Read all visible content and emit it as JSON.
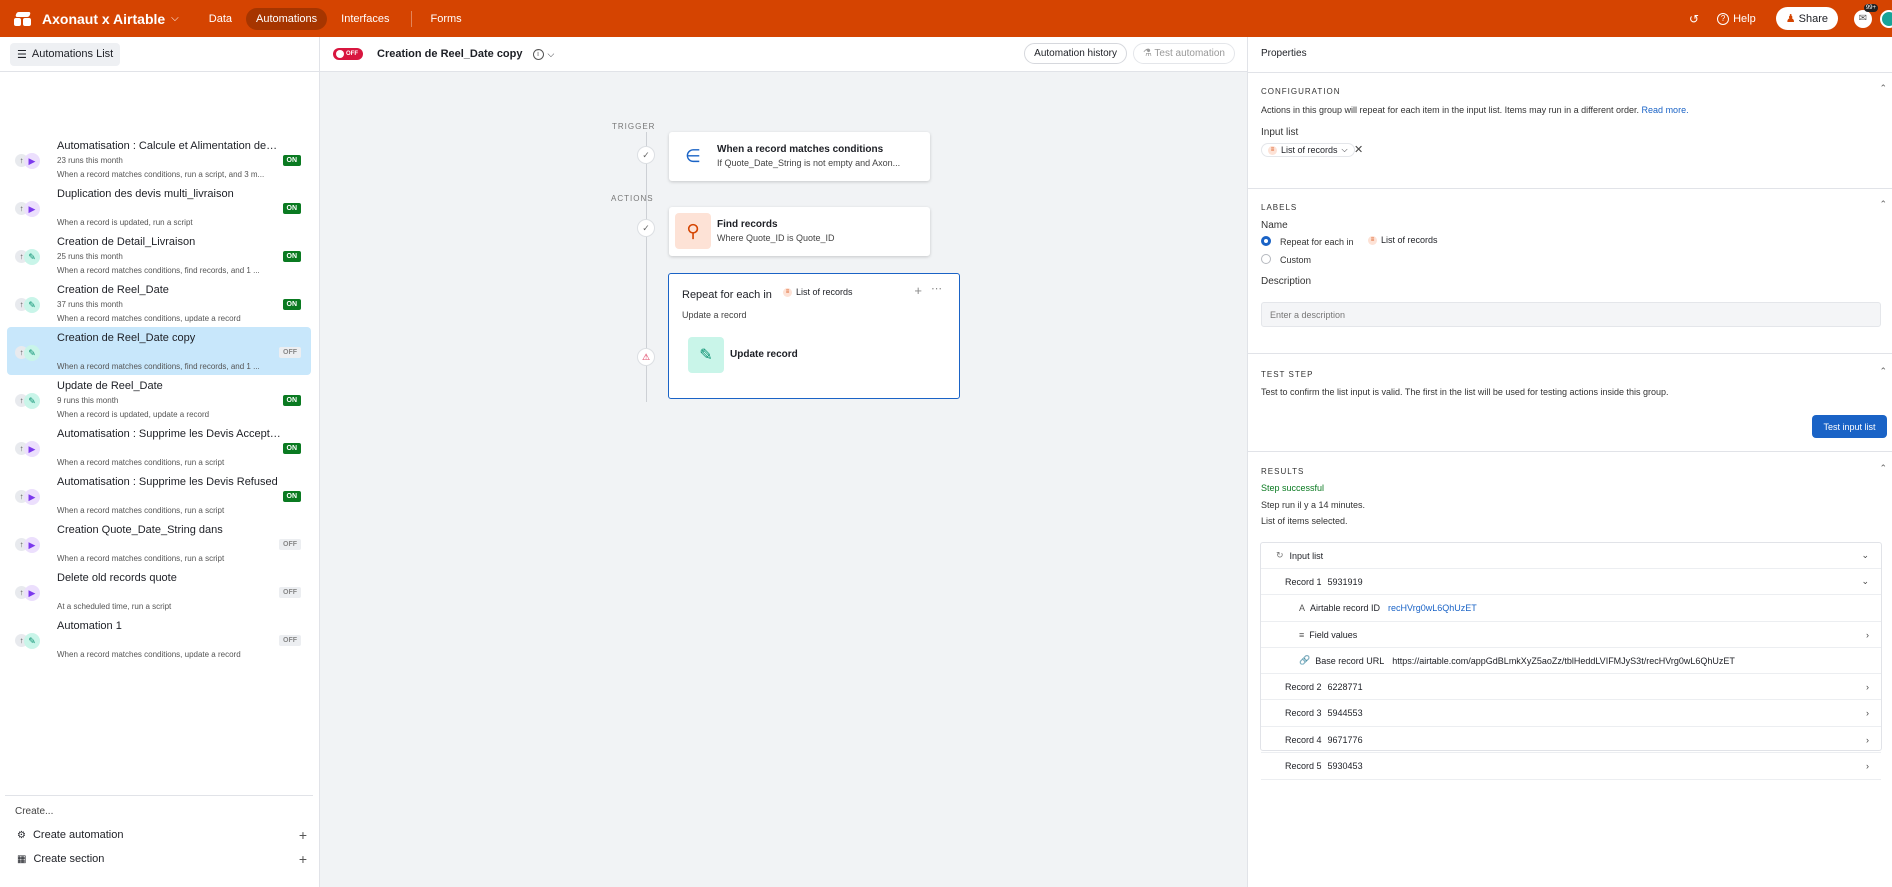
{
  "topbar": {
    "base_name": "Axonaut x Airtable",
    "tabs": [
      "Data",
      "Automations",
      "Interfaces",
      "Forms"
    ],
    "active_tab": "Automations",
    "help": "Help",
    "share": "Share",
    "notif_badge": "99+",
    "colors": {
      "bar": "#d54401"
    }
  },
  "sidebar": {
    "list_button": "Automations List",
    "automations": [
      {
        "title": "Automatisation : Calcule et Alimentation des t...",
        "runs": "23 runs this month",
        "desc": "When a record matches conditions, run a script, and 3 m...",
        "status": "ON",
        "icon": "script"
      },
      {
        "title": "Duplication des devis multi_livraison",
        "runs": "",
        "desc": "When a record is updated, run a script",
        "status": "ON",
        "icon": "script"
      },
      {
        "title": "Creation de Detail_Livraison",
        "runs": "25 runs this month",
        "desc": "When a record matches conditions, find records, and 1 ...",
        "status": "ON",
        "icon": "update"
      },
      {
        "title": "Creation de Reel_Date",
        "runs": "37 runs this month",
        "desc": "When a record matches conditions, update a record",
        "status": "ON",
        "icon": "update"
      },
      {
        "title": "Creation de Reel_Date copy",
        "runs": "",
        "desc": "When a record matches conditions, find records, and 1 ...",
        "status": "OFF",
        "icon": "update"
      },
      {
        "title": "Update de Reel_Date",
        "runs": "9 runs this month",
        "desc": "When a record is updated, update a record",
        "status": "ON",
        "icon": "update"
      },
      {
        "title": "Automatisation : Supprime les Devis Accepted...",
        "runs": "",
        "desc": "When a record matches conditions, run a script",
        "status": "ON",
        "icon": "script"
      },
      {
        "title": "Automatisation : Supprime les Devis Refused",
        "runs": "",
        "desc": "When a record matches conditions, run a script",
        "status": "ON",
        "icon": "script"
      },
      {
        "title": "Creation Quote_Date_String dans",
        "runs": "",
        "desc": "When a record matches conditions, run a script",
        "status": "OFF",
        "icon": "script"
      },
      {
        "title": "Delete old records quote",
        "runs": "",
        "desc": "At a scheduled time, run a script",
        "status": "OFF",
        "icon": "script"
      },
      {
        "title": "Automation 1",
        "runs": "",
        "desc": "When a record matches conditions, update a record",
        "status": "OFF",
        "icon": "update"
      }
    ],
    "create_label": "Create...",
    "create_automation": "Create automation",
    "create_section": "Create section"
  },
  "canvas": {
    "toggle": "OFF",
    "automation_name": "Creation de Reel_Date copy",
    "history_button": "Automation history",
    "test_button": "Test automation",
    "trigger_label": "TRIGGER",
    "actions_label": "ACTIONS",
    "trigger_card": {
      "title": "When a record matches conditions",
      "subtitle": "If Quote_Date_String is not empty and Axon..."
    },
    "find_card": {
      "title": "Find records",
      "subtitle": "Where Quote_ID is Quote_ID"
    },
    "repeat_card": {
      "title": "Repeat for each in",
      "chip": "List of records",
      "subtitle": "Update a record",
      "inner_action": "Update record"
    }
  },
  "properties": {
    "title": "Properties",
    "configuration": {
      "heading": "CONFIGURATION",
      "text": "Actions in this group will repeat for each item in the input list. Items may run in a different order.",
      "read_more": "Read more.",
      "input_list_label": "Input list",
      "input_list_value": "List of records"
    },
    "labels": {
      "heading": "LABELS",
      "name_label": "Name",
      "option_repeat": "Repeat for each in",
      "option_repeat_chip": "List of records",
      "option_custom": "Custom",
      "description_label": "Description",
      "description_placeholder": "Enter a description"
    },
    "test_step": {
      "heading": "TEST STEP",
      "text": "Test to confirm the list input is valid. The first in the list will be used for testing actions inside this group.",
      "button": "Test input list"
    },
    "results": {
      "heading": "RESULTS",
      "status": "Step successful",
      "run_time": "Step run il y a 14 minutes.",
      "list_label": "List of items selected.",
      "input_list": "Input list",
      "records": [
        {
          "label": "Record 1",
          "value": "5931919",
          "expanded": true
        },
        {
          "label": "Record 2",
          "value": "6228771",
          "expanded": false
        },
        {
          "label": "Record 3",
          "value": "5944553",
          "expanded": false
        },
        {
          "label": "Record 4",
          "value": "9671776",
          "expanded": false
        },
        {
          "label": "Record 5",
          "value": "5930453",
          "expanded": false
        }
      ],
      "record1_fields": {
        "id_label": "Airtable record ID",
        "id_value": "recHVrg0wL6QhUzET",
        "field_values": "Field values",
        "url_label": "Base record URL",
        "url_value": "https://airtable.com/appGdBLmkXyZ5aoZz/tblHeddLVIFMJyS3t/recHVrg0wL6QhUzET"
      },
      "success_color": "#0a7a21"
    }
  }
}
